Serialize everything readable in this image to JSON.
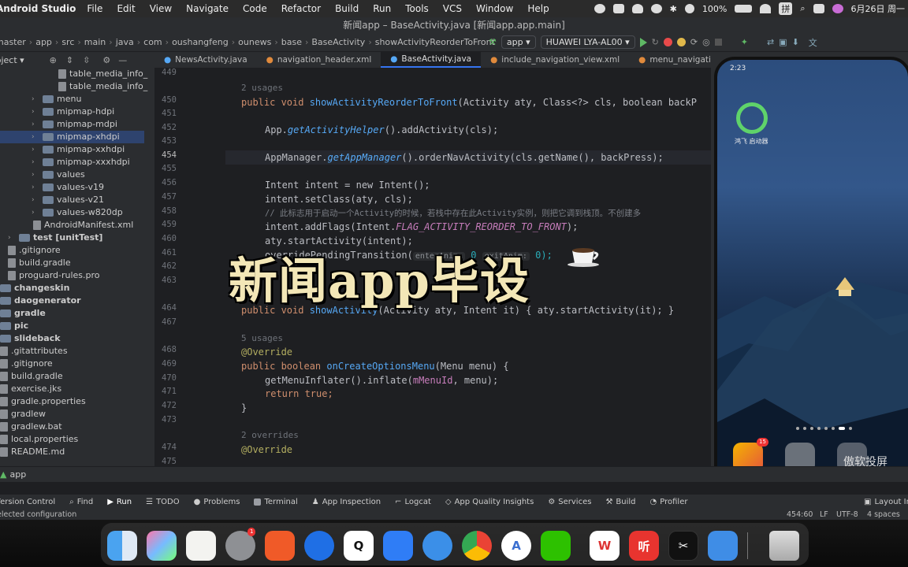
{
  "menubar": {
    "app": "Android Studio",
    "items": [
      "File",
      "Edit",
      "View",
      "Navigate",
      "Code",
      "Refactor",
      "Build",
      "Run",
      "Tools",
      "VCS",
      "Window",
      "Help"
    ],
    "battery": "100%",
    "ime": "拼",
    "date": "6月26日 周一"
  },
  "title": "新闻app – BaseActivity.java [新闻app.app.main]",
  "breadcrumb": [
    "master",
    "app",
    "src",
    "main",
    "java",
    "com",
    "oushangfeng",
    "ounews",
    "base",
    "BaseActivity",
    "showActivityReorderToFront"
  ],
  "run_config": "app",
  "device": "HUAWEI LYA-AL00",
  "project_label": "Project",
  "tree": [
    {
      "label": "table_media_info_",
      "type": "file",
      "indent": 74
    },
    {
      "label": "table_media_info_",
      "type": "file",
      "indent": 74
    },
    {
      "label": "menu",
      "type": "folder",
      "indent": 40,
      "chev": "›"
    },
    {
      "label": "mipmap-hdpi",
      "type": "folder",
      "indent": 40,
      "chev": "›"
    },
    {
      "label": "mipmap-mdpi",
      "type": "folder",
      "indent": 40,
      "chev": "›"
    },
    {
      "label": "mipmap-xhdpi",
      "type": "folder",
      "indent": 40,
      "chev": "›",
      "selected": true
    },
    {
      "label": "mipmap-xxhdpi",
      "type": "folder",
      "indent": 40,
      "chev": "›"
    },
    {
      "label": "mipmap-xxxhdpi",
      "type": "folder",
      "indent": 40,
      "chev": "›"
    },
    {
      "label": "values",
      "type": "folder",
      "indent": 40,
      "chev": "›"
    },
    {
      "label": "values-v19",
      "type": "folder",
      "indent": 40,
      "chev": "›"
    },
    {
      "label": "values-v21",
      "type": "folder",
      "indent": 40,
      "chev": "›"
    },
    {
      "label": "values-w820dp",
      "type": "folder",
      "indent": 40,
      "chev": "›"
    },
    {
      "label": "AndroidManifest.xml",
      "type": "file",
      "indent": 42
    },
    {
      "label": "test [unitTest]",
      "type": "folder",
      "indent": 10,
      "chev": "›"
    },
    {
      "label": ".gitignore",
      "type": "file",
      "indent": 10
    },
    {
      "label": "build.gradle",
      "type": "file",
      "indent": 10
    },
    {
      "label": "proguard-rules.pro",
      "type": "file",
      "indent": 10
    },
    {
      "label": "changeskin",
      "type": "folder",
      "indent": -6
    },
    {
      "label": "daogenerator",
      "type": "folder",
      "indent": -6
    },
    {
      "label": "gradle",
      "type": "folder",
      "indent": -6
    },
    {
      "label": "pic",
      "type": "folder",
      "indent": -6
    },
    {
      "label": "slideback",
      "type": "folder",
      "indent": -6
    },
    {
      "label": ".gitattributes",
      "type": "file",
      "indent": -6
    },
    {
      "label": ".gitignore",
      "type": "file",
      "indent": -6
    },
    {
      "label": "build.gradle",
      "type": "file",
      "indent": -6
    },
    {
      "label": "exercise.jks",
      "type": "file",
      "indent": -6
    },
    {
      "label": "gradle.properties",
      "type": "file",
      "indent": -6
    },
    {
      "label": "gradlew",
      "type": "file",
      "indent": -6
    },
    {
      "label": "gradlew.bat",
      "type": "file",
      "indent": -6
    },
    {
      "label": "local.properties",
      "type": "file",
      "indent": -6
    },
    {
      "label": "README.md",
      "type": "file",
      "indent": -6
    }
  ],
  "tabs": [
    "NewsActivity.java",
    "navigation_header.xml",
    "BaseActivity.java",
    "include_navigation_view.xml",
    "menu_navigation.xml"
  ],
  "active_tab": 2,
  "gutter": [
    "449",
    "450",
    "451",
    "452",
    "453",
    "454",
    "455",
    "456",
    "457",
    "458",
    "459",
    "460",
    "461",
    "462",
    "463",
    "",
    "464",
    "467",
    "",
    "468",
    "469",
    "470",
    "471",
    "472",
    "473",
    "",
    "474",
    "475"
  ],
  "code": {
    "usages1": "2 usages",
    "l450a": "public void ",
    "l450b": "showActivityReorderToFront",
    "l450c": "(Activity aty, Class<?> cls, boolean backP",
    "l452a": "App.",
    "l452b": "getActivityHelper",
    "l452c": "().addActivity(cls);",
    "l454a": "AppManager.",
    "l454b": "getAppManager",
    "l454c": "().orderNavActivity(cls.getName(), backPress);",
    "l456": "Intent intent = new Intent();",
    "l457": "intent.setClass(aty, cls);",
    "l458": "// 此标志用于启动一个Activity的时候，若栈中存在此Activity实例，则把它调到栈顶。不创建多",
    "l459a": "intent.addFlags(Intent.",
    "l459b": "FLAG_ACTIVITY_REORDER_TO_FRONT",
    "l459c": ");",
    "l460": "aty.startActivity(intent);",
    "l461a": "overridePendingTransition(",
    "l461h1": "enterAnim:",
    "l461n": " 0",
    "l461h2": "exitAnim:",
    "l461n2": " 0);",
    "l464a": "public void ",
    "l464b": "showActivity",
    "l464c": "(Activity aty, Intent it) { aty.startActivity(it); }",
    "usages2": "5 usages",
    "ann": "@Override",
    "l469a": "public boolean ",
    "l469b": "onCreateOptionsMenu",
    "l469c": "(Menu menu) {",
    "l470a": "getMenuInflater",
    "l470b": "().inflate(",
    "l470c": "mMenuId",
    "l470d": ", menu);",
    "l471": "return true;",
    "l472": "}",
    "overrides": "2 overrides"
  },
  "watermark": "新闻app毕设",
  "phone": {
    "time": "2:23",
    "launcher": "鸿飞 启动器",
    "badge": "15",
    "watermark": "傲软投屏"
  },
  "run_tab": "app",
  "toolwindows": [
    "Version Control",
    "Find",
    "Run",
    "TODO",
    "Problems",
    "Terminal",
    "App Inspection",
    "Logcat",
    "App Quality Insights",
    "Services",
    "Build",
    "Profiler",
    "Layout In"
  ],
  "status_left": "Selected configuration",
  "status_right": [
    "454:60",
    "LF",
    "UTF-8",
    "4 spaces"
  ],
  "dock": {
    "badge": "1"
  }
}
